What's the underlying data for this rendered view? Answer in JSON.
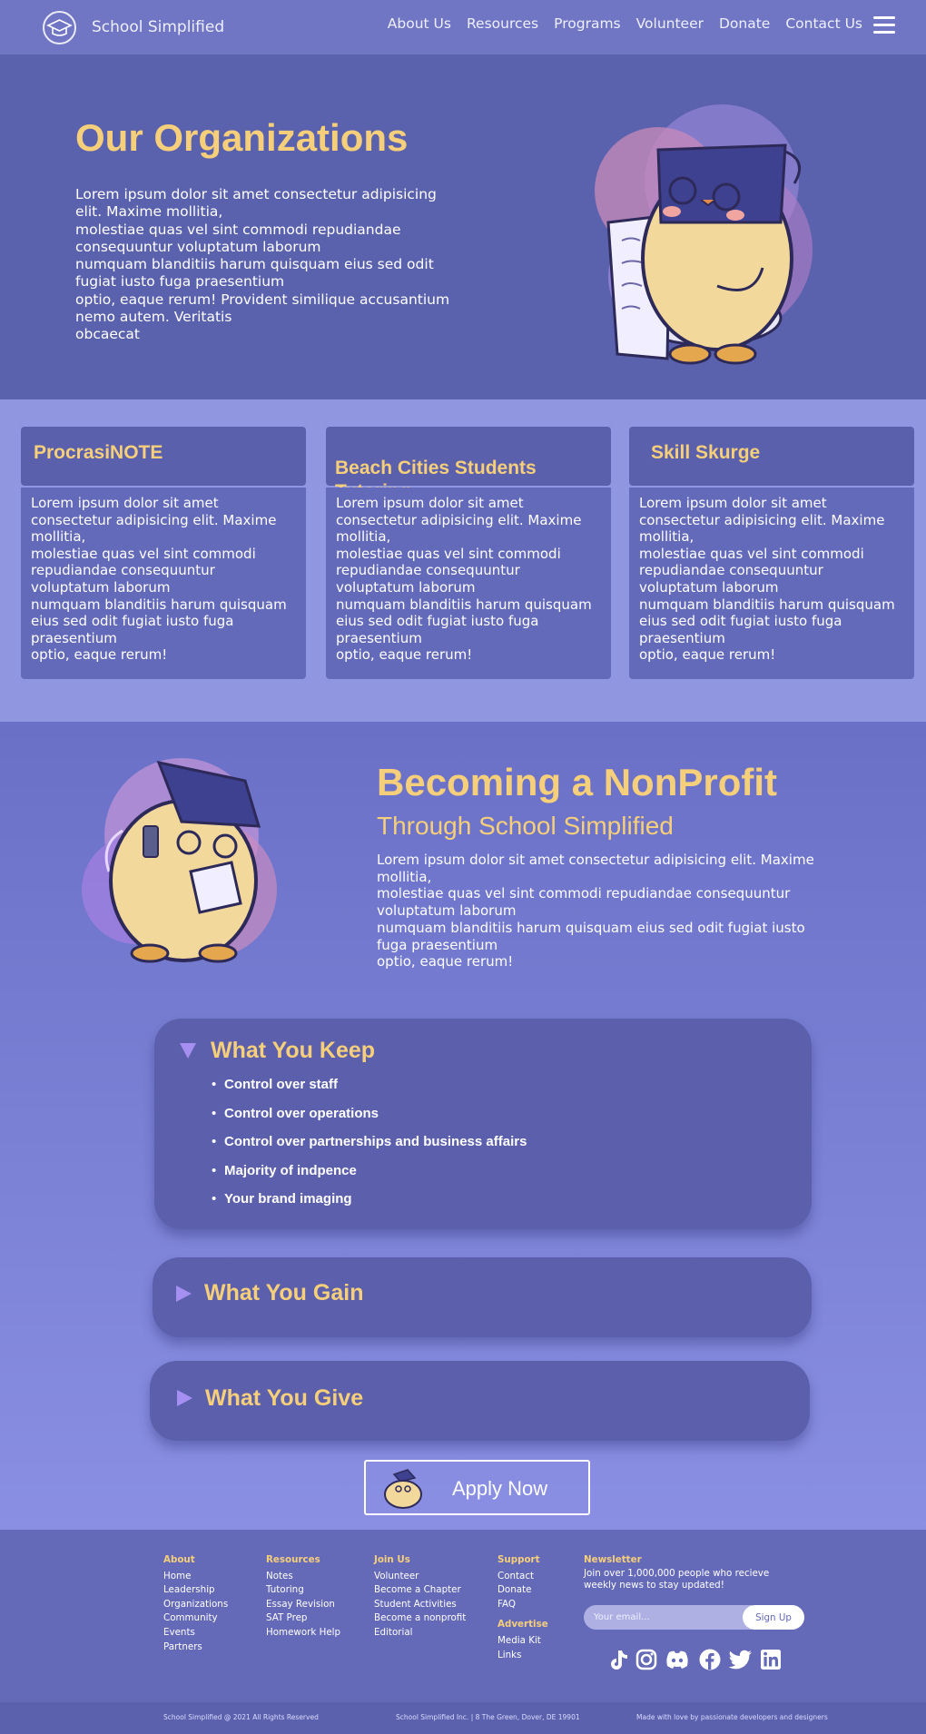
{
  "nav": {
    "logo_text": "School Simplified",
    "links": [
      "About Us",
      "Resources",
      "Programs",
      "Volunteer",
      "Donate",
      "Contact Us"
    ]
  },
  "hero": {
    "title": "Our Organizations",
    "text": "Lorem ipsum dolor sit amet consectetur adipisicing\nelit. Maxime mollitia,\nmolestiae quas vel sint commodi repudiandae\nconsequuntur voluptatum laborum\nnumquam blanditiis harum quisquam eius sed odit\nfugiat iusto fuga praesentium\noptio, eaque rerum! Provident similique accusantium\nnemo autem. Veritatis\nobcaecat"
  },
  "orgs": [
    {
      "name": "ProcrasiNOTE",
      "text": "Lorem ipsum dolor sit amet\nconsectetur adipisicing elit. Maxime\nmollitia,\nmolestiae quas vel sint commodi\nrepudiandae consequuntur\nvoluptatum laborum\nnumquam blanditiis harum quisquam\neius sed odit fugiat iusto fuga\npraesentium\noptio, eaque rerum!"
    },
    {
      "name": "Beach Cities Students\nTutoring",
      "text": "Lorem ipsum dolor sit amet\nconsectetur adipisicing elit. Maxime\nmollitia,\nmolestiae quas vel sint commodi\nrepudiandae consequuntur\nvoluptatum laborum\nnumquam blanditiis harum quisquam\neius sed odit fugiat iusto fuga\npraesentium\noptio, eaque rerum!"
    },
    {
      "name": "Skill Skurge",
      "text": "Lorem ipsum dolor sit amet\nconsectetur adipisicing elit. Maxime\nmollitia,\nmolestiae quas vel sint commodi\nrepudiandae consequuntur\nvoluptatum laborum\nnumquam blanditiis harum quisquam\neius sed odit fugiat iusto fuga\npraesentium\noptio, eaque rerum!"
    }
  ],
  "nonprofit": {
    "title": "Becoming a NonProfit",
    "subtitle": "Through School Simplified",
    "text": "Lorem ipsum dolor sit amet consectetur adipisicing elit. Maxime\nmollitia,\nmolestiae quas vel sint commodi repudiandae consequuntur\nvoluptatum laborum\nnumquam blanditiis harum quisquam eius sed odit fugiat iusto\nfuga praesentium\noptio, eaque rerum!"
  },
  "accordion": {
    "keep": {
      "title": "What You Keep",
      "state": "expanded",
      "items": [
        "Control over staff",
        "Control over operations",
        "Control over partnerships and business affairs",
        "Majority of indpence",
        "Your brand imaging"
      ]
    },
    "gain": {
      "title": "What You Gain",
      "state": "collapsed"
    },
    "give": {
      "title": "What You Give",
      "state": "collapsed"
    }
  },
  "apply": {
    "label": "Apply Now"
  },
  "footer": {
    "columns": [
      {
        "heading": "About",
        "links": [
          "Home",
          "Leadership",
          "Organizations",
          "Community",
          "Events",
          "Partners"
        ]
      },
      {
        "heading": "Resources",
        "links": [
          "Notes",
          "Tutoring",
          "Essay Revision",
          "SAT Prep",
          "Homework Help"
        ]
      },
      {
        "heading": "Join Us",
        "links": [
          "Volunteer",
          "Become a Chapter",
          "Student Activities",
          "Become a nonprofit",
          "Editorial"
        ]
      },
      {
        "heading": "Support",
        "links": [
          "Contact",
          "Donate",
          "FAQ"
        ]
      },
      {
        "heading": "Advertise",
        "links": [
          "Media Kit",
          "Links"
        ]
      }
    ],
    "newsletter": {
      "heading": "Newsletter",
      "text": "Join over 1,000,000 people who recieve weekly news to stay updated!",
      "placeholder": "Your email...",
      "button": "Sign Up"
    },
    "social_icons": [
      "tiktok-icon",
      "instagram-icon",
      "discord-icon",
      "facebook-icon",
      "twitter-icon",
      "linkedin-icon"
    ],
    "bottom": {
      "left": "School Simplified @ 2021 All Rights Reserved",
      "center": "School Simplified Inc. | 8 The Green, Dover, DE 19901",
      "right": "Made with love by passionate developers and designers"
    }
  },
  "colors": {
    "accent_yellow": "#f6cf7b",
    "nav_bg": "#7075c4",
    "hero_bg": "#5b62ad",
    "orgs_bg": "#9097e0",
    "card_bg": "#5c60ac"
  }
}
